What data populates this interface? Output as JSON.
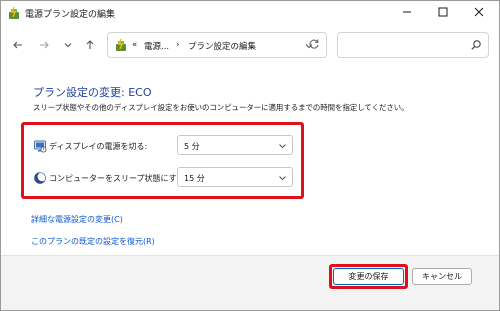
{
  "window": {
    "title": "電源プラン設定の編集"
  },
  "navbar": {
    "address_prefix": "«",
    "address_segment1": "電源...",
    "address_separator": "›",
    "address_segment2": "プラン設定の編集",
    "search_placeholder": ""
  },
  "page": {
    "title": "プラン設定の変更: ECO",
    "description": "スリープ状態やその他のディスプレイ設定をお使いのコンピューターに適用するまでの時間を指定してください。"
  },
  "settings": [
    {
      "label": "ディスプレイの電源を切る:",
      "value": "5 分",
      "icon": "monitor-icon"
    },
    {
      "label": "コンピューターをスリープ状態にする:",
      "value": "15 分",
      "icon": "moon-icon"
    }
  ],
  "links": {
    "advanced": "詳細な電源設定の変更(C)",
    "restore": "このプランの既定の設定を復元(R)"
  },
  "buttons": {
    "save": "変更の保存",
    "cancel": "キャンセル"
  },
  "colors": {
    "title_blue": "#1e3f9c",
    "link_blue": "#0b57d0",
    "highlight_red": "#e0101a"
  }
}
